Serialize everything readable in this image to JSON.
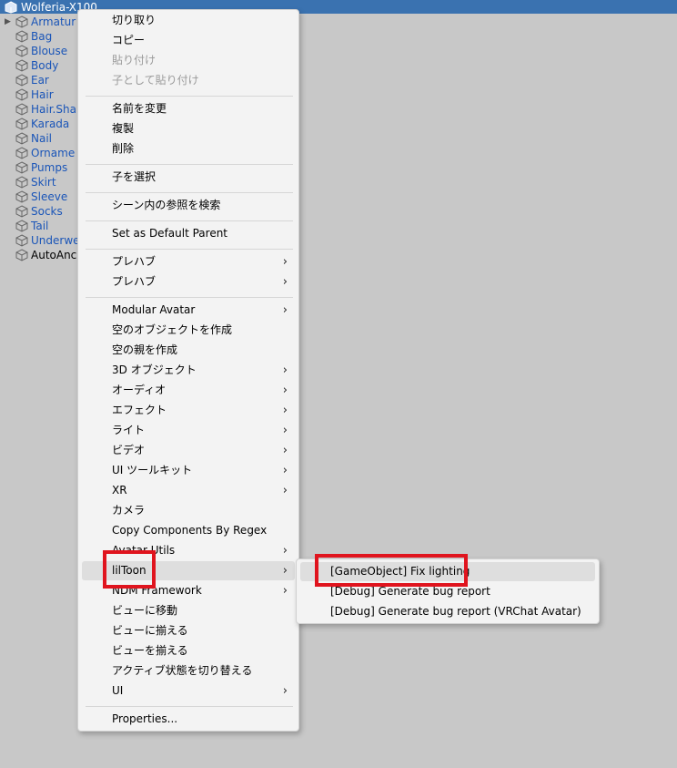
{
  "hierarchy": {
    "root": "Wolferia-X100",
    "items": [
      {
        "label": "Armatur",
        "expandable": true
      },
      {
        "label": "Bag"
      },
      {
        "label": "Blouse"
      },
      {
        "label": "Body"
      },
      {
        "label": "Ear"
      },
      {
        "label": "Hair"
      },
      {
        "label": "Hair.Sha"
      },
      {
        "label": "Karada"
      },
      {
        "label": "Nail"
      },
      {
        "label": "Orname"
      },
      {
        "label": "Pumps"
      },
      {
        "label": "Skirt"
      },
      {
        "label": "Sleeve"
      },
      {
        "label": "Socks"
      },
      {
        "label": "Tail"
      },
      {
        "label": "Underwe"
      },
      {
        "label": "AutoAnc",
        "special": true
      }
    ]
  },
  "context_menu": {
    "items": [
      {
        "label": "切り取り"
      },
      {
        "label": "コピー"
      },
      {
        "label": "貼り付け",
        "disabled": true
      },
      {
        "label": "子として貼り付け",
        "disabled": true
      },
      {
        "label": "名前を変更"
      },
      {
        "label": "複製"
      },
      {
        "label": "削除"
      },
      {
        "label": "子を選択"
      },
      {
        "label": "シーン内の参照を検索"
      },
      {
        "label": "Set as Default Parent"
      },
      {
        "label": "プレハブ",
        "submenu": true
      },
      {
        "label": "プレハブ",
        "submenu": true
      },
      {
        "label": "Modular Avatar",
        "submenu": true
      },
      {
        "label": "空のオブジェクトを作成"
      },
      {
        "label": "空の親を作成"
      },
      {
        "label": "3D オブジェクト",
        "submenu": true
      },
      {
        "label": "オーディオ",
        "submenu": true
      },
      {
        "label": "エフェクト",
        "submenu": true
      },
      {
        "label": "ライト",
        "submenu": true
      },
      {
        "label": "ビデオ",
        "submenu": true
      },
      {
        "label": "UI ツールキット",
        "submenu": true
      },
      {
        "label": "XR",
        "submenu": true
      },
      {
        "label": "カメラ"
      },
      {
        "label": "Copy Components By Regex"
      },
      {
        "label": "Avatar Utils",
        "submenu": true
      },
      {
        "label": "lilToon",
        "submenu": true,
        "highlighted": true
      },
      {
        "label": "NDM Framework",
        "submenu": true
      },
      {
        "label": "ビューに移動"
      },
      {
        "label": "ビューに揃える"
      },
      {
        "label": "ビューを揃える"
      },
      {
        "label": "アクティブ状態を切り替える"
      },
      {
        "label": "UI",
        "submenu": true
      },
      {
        "label": "Properties..."
      }
    ],
    "submenu_arrow": "›"
  },
  "liltoon_submenu": {
    "items": [
      {
        "label": "[GameObject] Fix lighting",
        "highlighted": true
      },
      {
        "label": "[Debug] Generate bug report"
      },
      {
        "label": "[Debug] Generate bug report (VRChat Avatar)"
      }
    ]
  },
  "colors": {
    "title_bar": "#3a72b0",
    "highlight_box": "#e0141e",
    "object_label": "#1a55b8"
  }
}
